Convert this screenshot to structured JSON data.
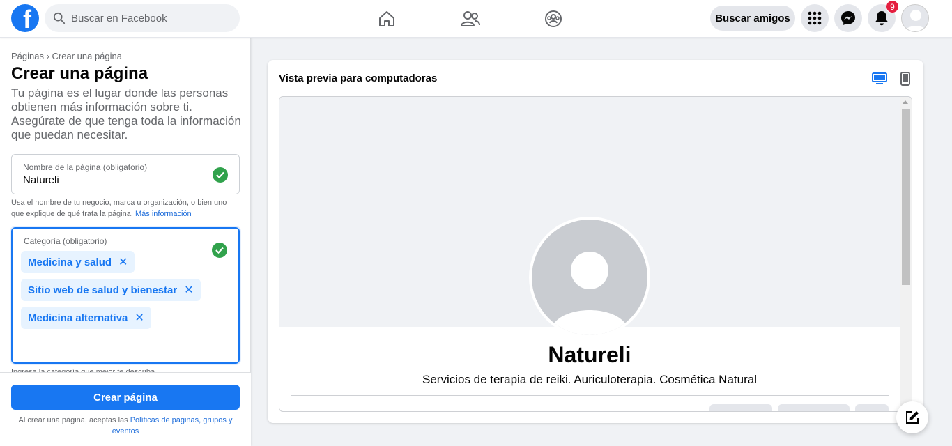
{
  "header": {
    "logo_letter": "f",
    "search_placeholder": "Buscar en Facebook",
    "find_friends_label": "Buscar amigos",
    "notifications_count": "9"
  },
  "sidebar": {
    "breadcrumb": "Páginas › Crear una página",
    "title": "Crear una página",
    "description": "Tu página es el lugar donde las personas obtienen más información sobre ti. Asegúrate de que tenga toda la información que puedan necesitar.",
    "name_field": {
      "label": "Nombre de la página (obligatorio)",
      "value": "Natureli"
    },
    "name_help": "Usa el nombre de tu negocio, marca u organización, o bien uno que explique de qué trata la página.",
    "more_info_link": "Más información",
    "category_field": {
      "label": "Categoría (obligatorio)",
      "chips": [
        "Medicina y salud",
        "Sitio web de salud y bienestar",
        "Medicina alternativa"
      ]
    },
    "category_help": "Ingresa la categoría que mejor te describa.",
    "create_button": "Crear página",
    "terms_prefix": "Al crear una página, aceptas las",
    "terms_link": "Políticas de páginas, grupos y eventos"
  },
  "preview": {
    "title": "Vista previa para computadoras",
    "page_name": "Natureli",
    "page_subtitle": "Servicios de terapia de reiki. Auriculoterapia. Cosmética Natural"
  },
  "colors": {
    "brand": "#1877f2",
    "success": "#31a24c",
    "badge": "#e41e3f"
  }
}
